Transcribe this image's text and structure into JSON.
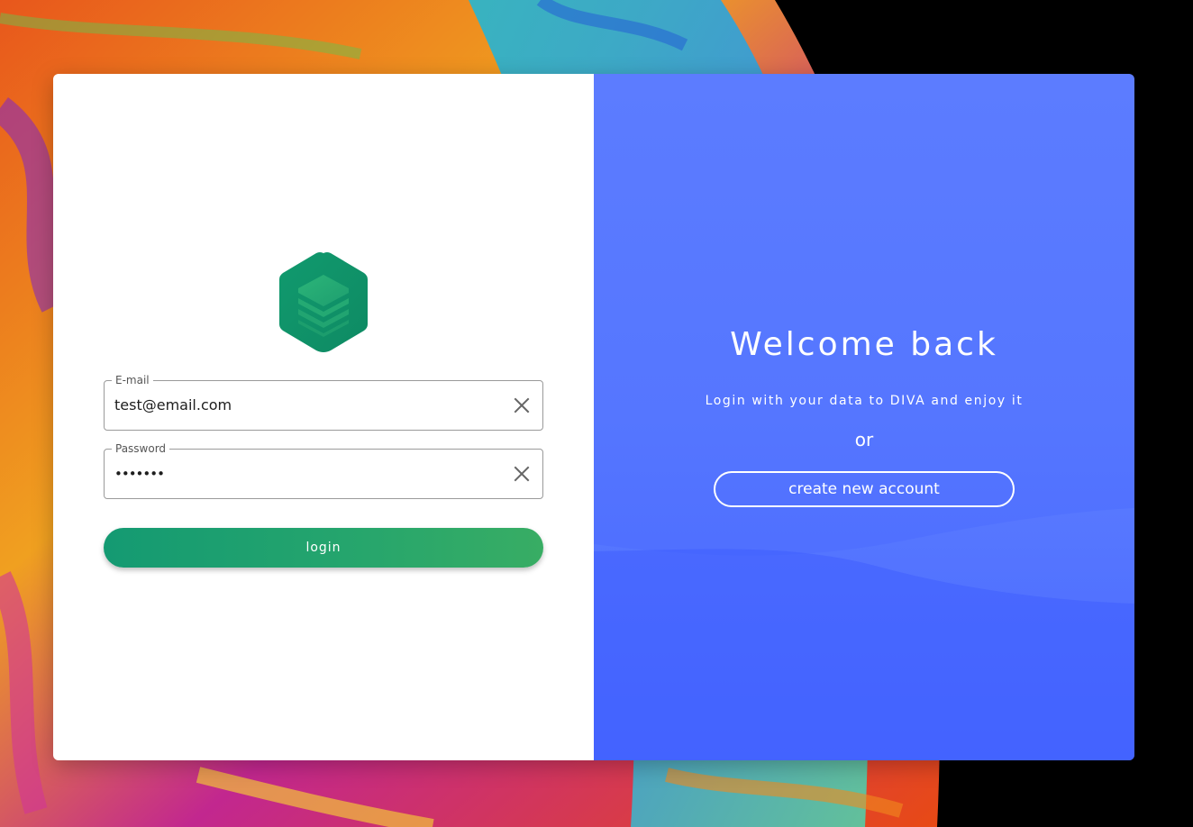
{
  "login_form": {
    "email": {
      "label": "E-mail",
      "value": "test@email.com"
    },
    "password": {
      "label": "Password",
      "value": "•••••••"
    },
    "login_label": "login"
  },
  "welcome_panel": {
    "title": "Welcome back",
    "subtitle": "Login with your data to DIVA and enjoy it",
    "or_text": "or",
    "create_account_label": "create new account"
  },
  "icons": {
    "logo": "hexagon-layers-logo",
    "clear": "close-icon"
  },
  "colors": {
    "brand_green": "#149a72",
    "panel_blue": "#5576ff"
  }
}
